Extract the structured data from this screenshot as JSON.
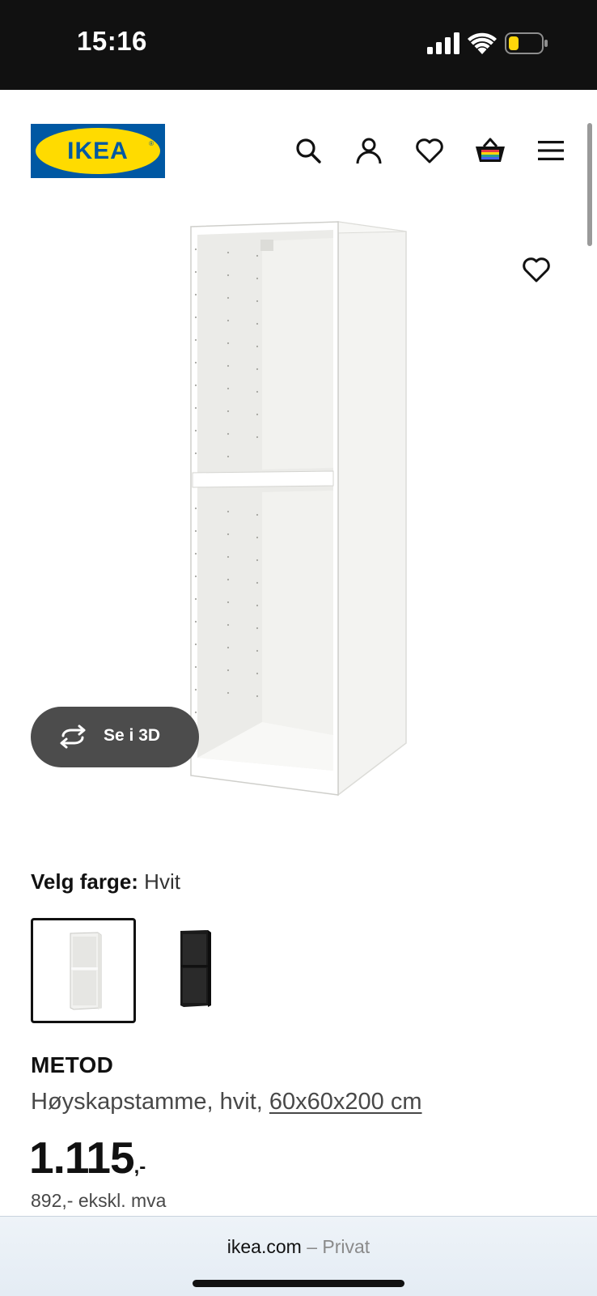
{
  "status_bar": {
    "time": "15:16",
    "icons": [
      "signal-icon",
      "wifi-icon",
      "battery-icon"
    ],
    "battery_color": "#ffd60a"
  },
  "header": {
    "logo_text": "IKEA",
    "logo_colors": {
      "blue": "#0058a3",
      "yellow": "#ffdb00"
    },
    "icons": [
      "search-icon",
      "user-icon",
      "heart-icon",
      "basket-icon",
      "menu-icon"
    ]
  },
  "product": {
    "image_icon": "cabinet-frame-white",
    "view_3d_label": "Se i 3D",
    "color_label": "Velg farge:",
    "color_value": "Hvit",
    "swatches": [
      {
        "name": "white",
        "selected": true
      },
      {
        "name": "black",
        "selected": false
      }
    ],
    "name": "METOD",
    "description": "Høyskapstamme, hvit, ",
    "dimensions": "60x60x200 cm",
    "price_int": "1.115",
    "price_suffix": ",-",
    "price_ex_vat": "892,- ekskl. mva"
  },
  "browser": {
    "url": "ikea.com",
    "separator": "–",
    "mode": "Privat"
  }
}
